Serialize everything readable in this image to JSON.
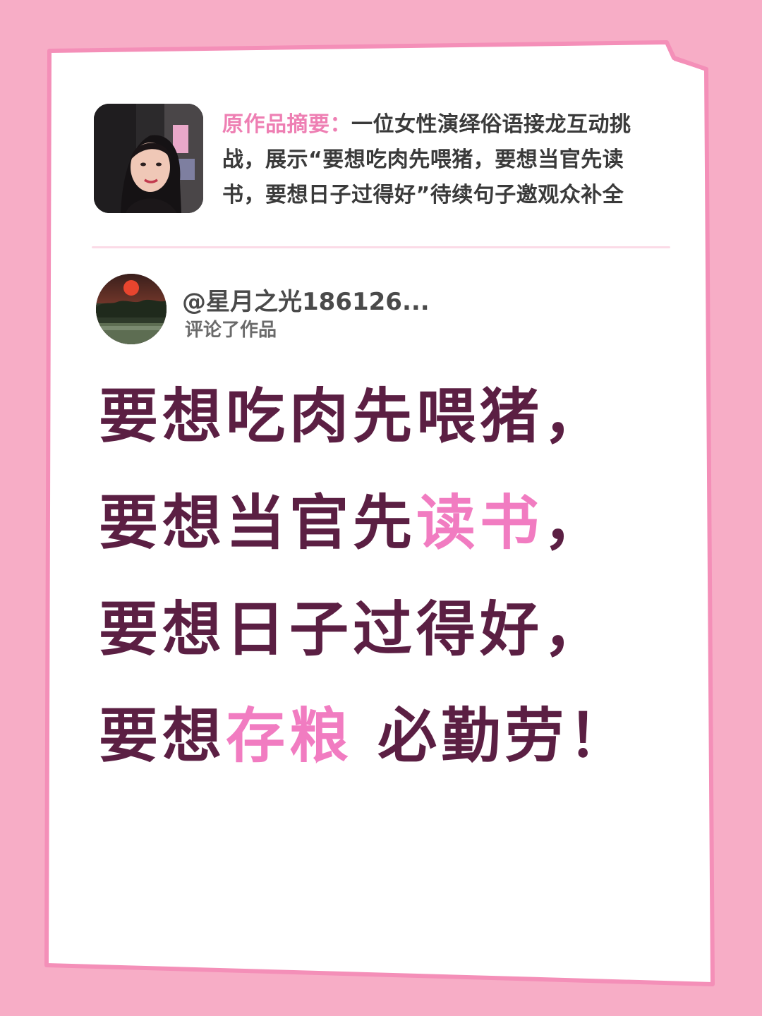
{
  "original_work": {
    "thumbnail": "woman-portrait-image",
    "label": "原作品摘要：",
    "summary": "一位女性演绎俗语接龙互动挑战，展示“要想吃肉先喂猪，要想当官先读书，要想日子过得好”待续句子邀观众补全"
  },
  "commenter": {
    "avatar": "sunset-landscape-image",
    "name": "@星月之光186126...",
    "action": "评论了作品"
  },
  "comment": {
    "segments": [
      {
        "text": "要想吃肉先喂猪，要想当官先",
        "highlight": false
      },
      {
        "text": "读书",
        "highlight": true
      },
      {
        "text": "，要想日子过得好，要想",
        "highlight": false
      },
      {
        "text": "存粮",
        "highlight": true
      },
      {
        "text": " 必勤劳！",
        "highlight": false
      }
    ]
  },
  "colors": {
    "background": "#f7adc6",
    "paper": "#ffffff",
    "paper_edge": "#f48fb8",
    "comment_text": "#5b1f43",
    "highlight": "#f17cc1",
    "summary_label": "#ee7fb3"
  }
}
